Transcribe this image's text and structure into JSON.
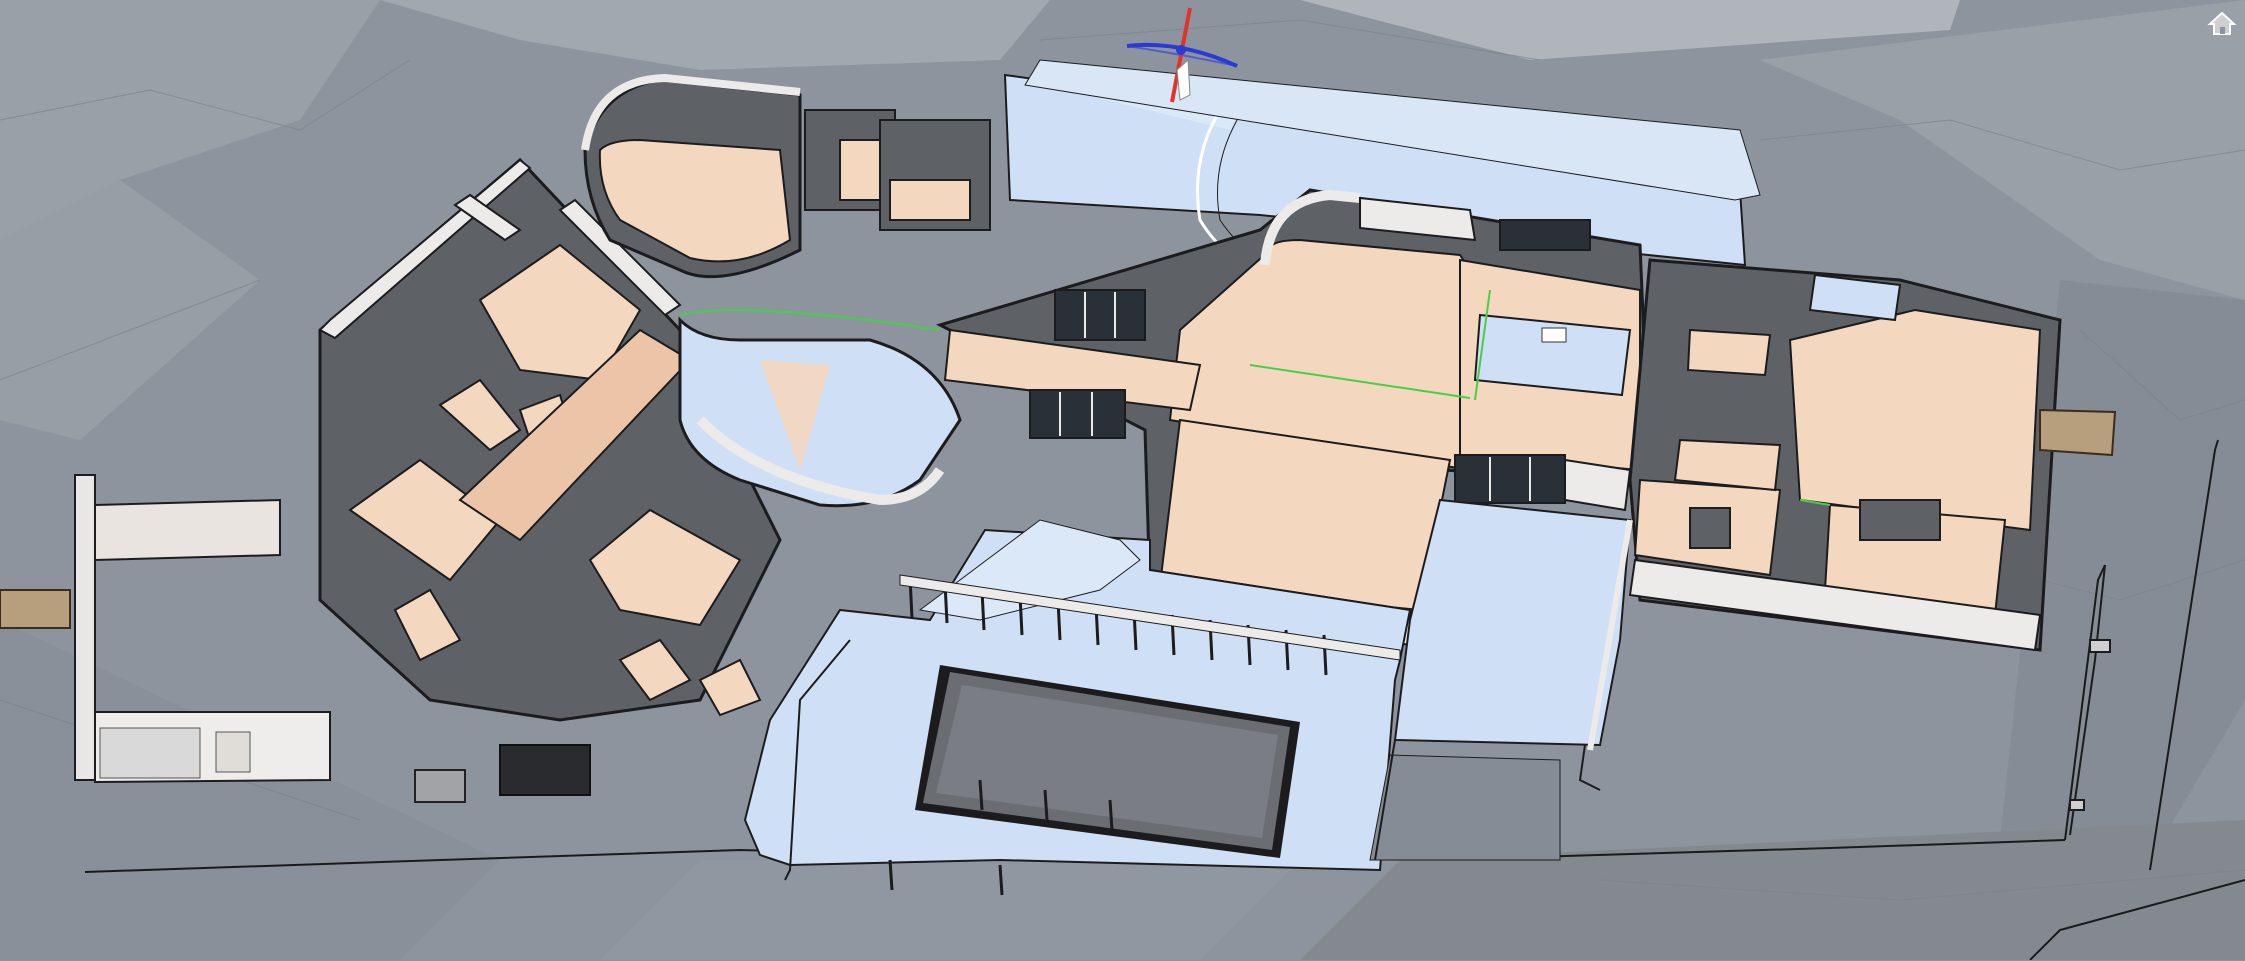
{
  "app": {
    "viewport_label": "",
    "home_icon": "home-icon",
    "gizmo_icon": "axis-gizmo-icon"
  },
  "colors": {
    "terrain": "#8e949d",
    "terrain_light": "#a9aeb6",
    "terrain_dark": "#7f858e",
    "floor": "#f3d7bf",
    "hardscape": "#cfe0f6",
    "wall_top": "#ecebea",
    "wall_side": "#6a6d72",
    "wall_edge": "#1c1c1e",
    "glass": "#2a3038",
    "axis_x": "#e0332b",
    "axis_y": "#2a3ad6",
    "axis_z": "#ffffff",
    "guide_line": "#44d04a"
  }
}
